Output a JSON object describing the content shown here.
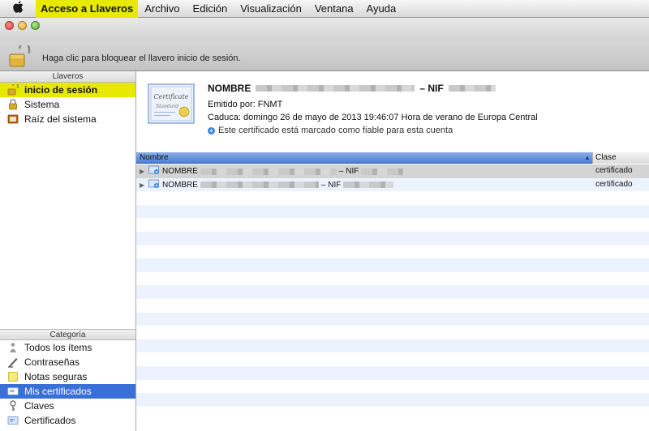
{
  "menubar": {
    "app": "Acceso a Llaveros",
    "items": [
      "Archivo",
      "Edición",
      "Visualización",
      "Ventana",
      "Ayuda"
    ]
  },
  "toolbar": {
    "lock_text": "Haga clic para bloquear el llavero inicio de sesión."
  },
  "keychains": {
    "header": "Llaveros",
    "items": [
      {
        "label": "inicio de sesión",
        "icon": "unlocked-keychain-icon"
      },
      {
        "label": "Sistema",
        "icon": "lock-keychain-icon"
      },
      {
        "label": "Raíz del sistema",
        "icon": "folder-keychain-icon"
      }
    ]
  },
  "category": {
    "header": "Categoría",
    "items": [
      {
        "label": "Todos los ítems",
        "icon": "people-icon"
      },
      {
        "label": "Contraseñas",
        "icon": "pen-icon"
      },
      {
        "label": "Notas seguras",
        "icon": "note-icon"
      },
      {
        "label": "Mis certificados",
        "icon": "my-certificate-icon"
      },
      {
        "label": "Claves",
        "icon": "key-icon"
      },
      {
        "label": "Certificados",
        "icon": "certificate-icon"
      }
    ]
  },
  "detail": {
    "name_prefix": "NOMBRE",
    "name_suffix": "– NIF",
    "issued_by": "Emitido por: FNMT",
    "expires": "Caduca: domingo 26 de mayo de 2013 19:46:07 Hora de verano de Europa Central",
    "trust": "Este certificado está marcado como fiable para esta cuenta"
  },
  "table": {
    "col_name": "Nombre",
    "col_class": "Clase",
    "rows": [
      {
        "name_prefix": "NOMBRE",
        "name_suffix": "– NIF",
        "class": "certificado"
      },
      {
        "name_prefix": "NOMBRE",
        "name_suffix": "– NIF",
        "class": "certificado"
      }
    ]
  },
  "colors": {
    "selection_yellow": "#e7ea00",
    "selection_blue": "#3a6fd8",
    "header_blue": "#4d7fd2"
  }
}
